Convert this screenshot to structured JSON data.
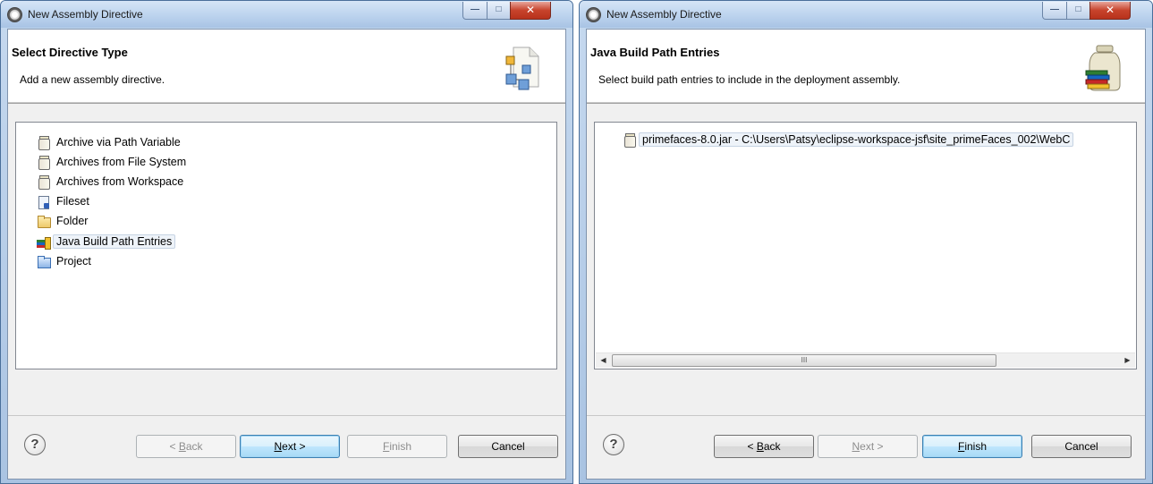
{
  "windows": [
    {
      "title": "New Assembly Directive",
      "header": {
        "title": "Select Directive Type",
        "description": "Add a new assembly directive."
      },
      "list_items": [
        {
          "label": "Archive via Path Variable",
          "icon": "jar-icon"
        },
        {
          "label": "Archives from File System",
          "icon": "jar-icon"
        },
        {
          "label": "Archives from Workspace",
          "icon": "jar-icon"
        },
        {
          "label": "Fileset",
          "icon": "fileset-icon"
        },
        {
          "label": "Folder",
          "icon": "folder-icon"
        },
        {
          "label": "Java Build Path Entries",
          "icon": "java-build-path-icon",
          "selected": true
        },
        {
          "label": "Project",
          "icon": "project-folder-icon"
        }
      ],
      "buttons": {
        "help": "?",
        "back": {
          "pre": "< ",
          "mnemonic": "B",
          "post": "ack",
          "enabled": false
        },
        "next": {
          "pre": "",
          "mnemonic": "N",
          "post": "ext >",
          "enabled": true,
          "default": true
        },
        "finish": {
          "pre": "",
          "mnemonic": "F",
          "post": "inish",
          "enabled": false
        },
        "cancel": {
          "label": "Cancel",
          "enabled": true
        }
      }
    },
    {
      "title": "New Assembly Directive",
      "header": {
        "title": "Java Build Path Entries",
        "description": "Select build path entries to include in the deployment assembly."
      },
      "list_items": [
        {
          "label": "primefaces-8.0.jar - C:\\Users\\Patsy\\eclipse-workspace-jsf\\site_primeFaces_002\\WebC",
          "icon": "jar-file-icon",
          "selected": true
        }
      ],
      "scrollbar": {
        "thumb_label": "III"
      },
      "buttons": {
        "help": "?",
        "back": {
          "pre": "< ",
          "mnemonic": "B",
          "post": "ack",
          "enabled": true
        },
        "next": {
          "pre": "",
          "mnemonic": "N",
          "post": "ext >",
          "enabled": false
        },
        "finish": {
          "pre": "",
          "mnemonic": "F",
          "post": "inish",
          "enabled": true,
          "default": true
        },
        "cancel": {
          "label": "Cancel",
          "enabled": true
        }
      }
    }
  ],
  "colors": {
    "accent": "#3c7fb1",
    "titlebar": "#bcd3ee",
    "dialog_bg": "#f0f0f0",
    "close_button": "#c7432c"
  }
}
